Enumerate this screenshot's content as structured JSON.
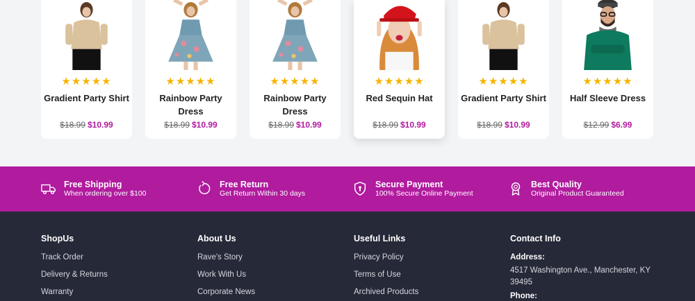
{
  "products": [
    {
      "name": "Gradient Party Shirt",
      "rating": 5,
      "old_price": "$18.99",
      "price": "$10.99",
      "image": "woman-satin-shirt-photo"
    },
    {
      "name": "Rainbow Party Dress",
      "rating": 5,
      "old_price": "$18.99",
      "price": "$10.99",
      "image": "woman-floral-dress-photo"
    },
    {
      "name": "Rainbow Party Dress",
      "rating": 5,
      "old_price": "$18.99",
      "price": "$10.99",
      "image": "woman-floral-dress-photo"
    },
    {
      "name": "Red Sequin Hat",
      "rating": 5,
      "old_price": "$18.99",
      "price": "$10.99",
      "image": "woman-red-hat-photo"
    },
    {
      "name": "Gradient Party Shirt",
      "rating": 5,
      "old_price": "$18.99",
      "price": "$10.99",
      "image": "woman-satin-shirt-photo"
    },
    {
      "name": "Half Sleeve Dress",
      "rating": 5,
      "old_price": "$12.99",
      "price": "$6.99",
      "image": "man-green-sweater-photo"
    }
  ],
  "stars": "★★★★★",
  "features": [
    {
      "icon": "truck-icon",
      "title": "Free Shipping",
      "subtitle": "When ordering over $100"
    },
    {
      "icon": "return-icon",
      "title": "Free Return",
      "subtitle": "Get Return Within 30 days"
    },
    {
      "icon": "shield-icon",
      "title": "Secure Payment",
      "subtitle": "100% Secure Online Payment"
    },
    {
      "icon": "badge-icon",
      "title": "Best Quality",
      "subtitle": "Original Product Guaranteed"
    }
  ],
  "footer": {
    "shopus": {
      "title": "ShopUs",
      "links": [
        "Track Order",
        "Delivery & Returns",
        "Warranty"
      ]
    },
    "about": {
      "title": "About Us",
      "links": [
        "Rave's Story",
        "Work With Us",
        "Corporate News"
      ]
    },
    "useful": {
      "title": "Useful Links",
      "links": [
        "Privacy Policy",
        "Terms of Use",
        "Archived Products"
      ]
    },
    "contact": {
      "title": "Contact Info",
      "address_label": "Address:",
      "address": "4517 Washington Ave., Manchester, KY 39495",
      "phone_label": "Phone:"
    }
  },
  "colors": {
    "accent": "#b11b9e",
    "footer_bg": "#262938",
    "star": "#f5b400",
    "page_bg": "#f3f4f6"
  }
}
